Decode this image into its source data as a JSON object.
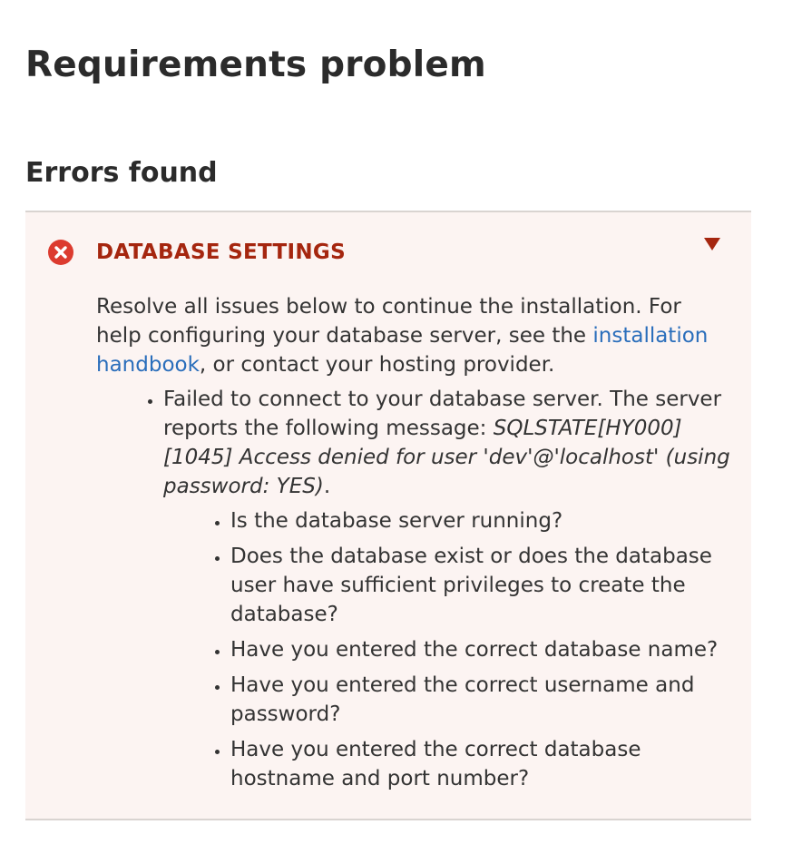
{
  "page": {
    "title": "Requirements problem"
  },
  "errors": {
    "heading": "Errors found",
    "panel": {
      "title": "DATABASE SETTINGS",
      "error_icon": "error-x-circle-icon",
      "toggle_icon": "triangle-down-icon",
      "intro_before_link": "Resolve all issues below to continue the installation. For help configuring your database server, see the ",
      "link_text": "installation handbook",
      "intro_after_link": ", or contact your hosting provider.",
      "failure": {
        "text_before": "Failed to connect to your database server. The server reports the following message: ",
        "message": "SQLSTATE[HY000] [1045] Access denied for user 'dev'@'localhost' (using password: YES)",
        "text_after": ".",
        "checks": [
          "Is the database server running?",
          "Does the database exist or does the database user have sufficient privileges to create the database?",
          "Have you entered the correct database name?",
          "Have you entered the correct username and password?",
          "Have you entered the correct database hostname and port number?"
        ]
      }
    }
  },
  "colors": {
    "panel_background": "#fcf4f2",
    "error_title": "#a5260f",
    "error_icon": "#dc3b2f",
    "link": "#2a6ebb"
  }
}
